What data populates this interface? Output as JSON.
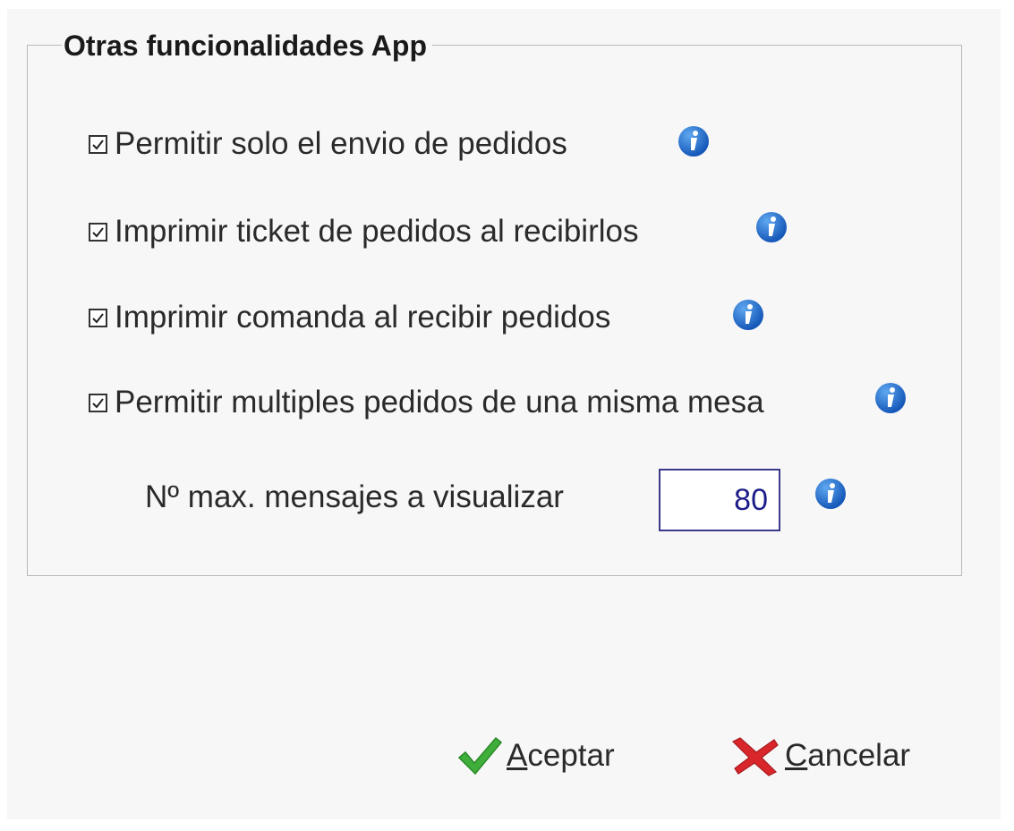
{
  "group": {
    "title": "Otras funcionalidades App"
  },
  "options": [
    {
      "label": "Permitir solo el envio de pedidos",
      "checked": true,
      "icon": "info-icon"
    },
    {
      "label": "Imprimir ticket de pedidos al recibirlos",
      "checked": true,
      "icon": "info-icon"
    },
    {
      "label": "Imprimir comanda al recibir pedidos",
      "checked": true,
      "icon": "info-icon"
    },
    {
      "label": "Permitir multiples pedidos de una misma mesa",
      "checked": true,
      "icon": "info-icon"
    }
  ],
  "max_messages": {
    "label": "Nº max. mensajes a visualizar",
    "value": "80",
    "icon": "info-icon"
  },
  "buttons": {
    "accept": {
      "mnemonic": "A",
      "rest": "ceptar",
      "icon": "checkmark-icon"
    },
    "cancel": {
      "mnemonic": "C",
      "rest": "ancelar",
      "icon": "cross-icon"
    }
  },
  "colors": {
    "info_blue": "#1e6fd0",
    "accept_green": "#3fae3a",
    "cancel_red": "#d8262b",
    "input_border": "#3a3a8a"
  }
}
